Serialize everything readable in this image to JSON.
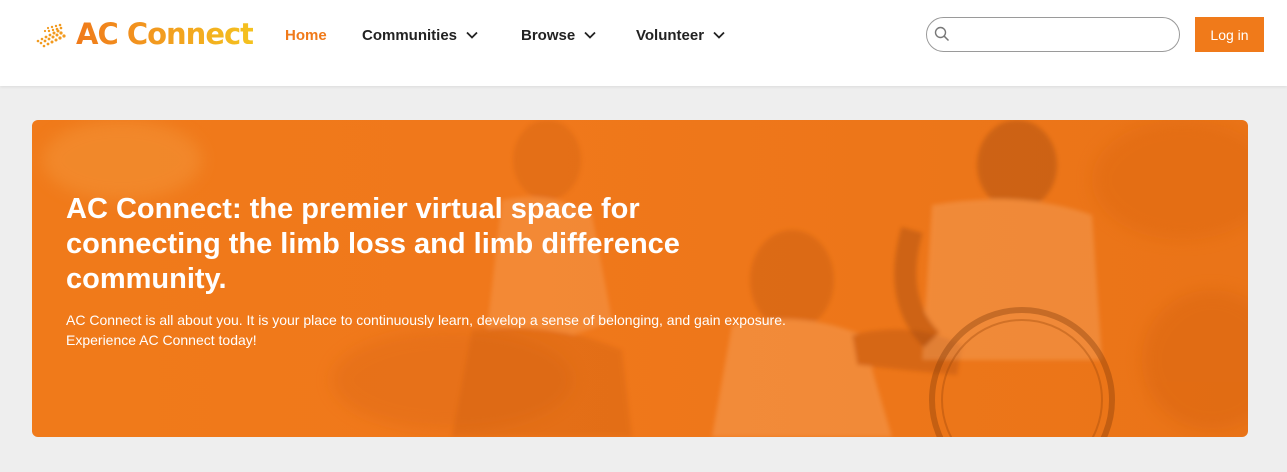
{
  "brand": {
    "logo_text": "AC Connect"
  },
  "nav": {
    "home": "Home",
    "communities": "Communities",
    "browse": "Browse",
    "volunteer": "Volunteer"
  },
  "search": {
    "value": "",
    "placeholder": ""
  },
  "auth": {
    "login_label": "Log in"
  },
  "hero": {
    "title": "AC Connect: the premier virtual space for connecting the limb loss and limb difference community.",
    "subtitle": "AC Connect is all about you. It is your place to continuously learn, develop a sense of belonging, and gain exposure. Experience AC Connect today!"
  },
  "colors": {
    "accent": "#f07a1a",
    "nav_text": "#222222",
    "page_bg": "#eeeeee"
  }
}
